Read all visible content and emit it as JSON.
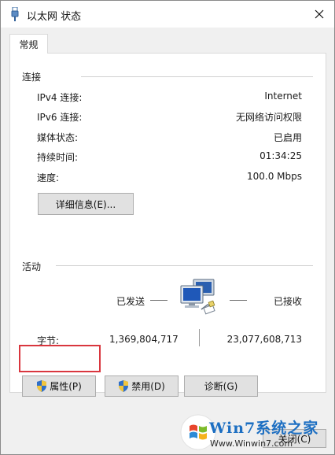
{
  "window": {
    "title": "以太网 状态",
    "close_icon": "close-icon"
  },
  "tabs": [
    {
      "label": "常规"
    }
  ],
  "connection": {
    "group_title": "连接",
    "rows": [
      {
        "label": "IPv4 连接:",
        "value": "Internet"
      },
      {
        "label": "IPv6 连接:",
        "value": "无网络访问权限"
      },
      {
        "label": "媒体状态:",
        "value": "已启用"
      },
      {
        "label": "持续时间:",
        "value": "01:34:25"
      },
      {
        "label": "速度:",
        "value": "100.0 Mbps"
      }
    ],
    "details_button": "详细信息(E)..."
  },
  "activity": {
    "group_title": "活动",
    "sent_label": "已发送",
    "received_label": "已接收",
    "bytes_label": "字节:",
    "bytes_sent": "1,369,804,717",
    "bytes_received": "23,077,608,713",
    "network_icon": "network-computers-icon"
  },
  "buttons": {
    "properties": "属性(P)",
    "disable": "禁用(D)",
    "diagnose": "诊断(G)",
    "close": "关闭(C)"
  },
  "watermark": {
    "brand": "Win7系统之家",
    "url": "Www.Winwin7.com"
  },
  "colors": {
    "accent_highlight": "#d9363e",
    "watermark_blue": "#1d6fc2",
    "dialog_bg": "#f0f0f0",
    "button_bg": "#e1e1e1"
  }
}
